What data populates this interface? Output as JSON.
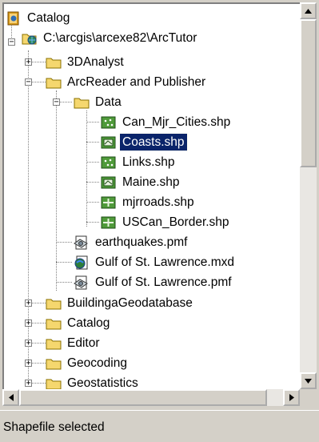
{
  "tree": {
    "root_label": "Catalog",
    "connection_label": "C:\\arcgis\\arcexe82\\ArcTutor",
    "items": {
      "analyst": "3DAnalyst",
      "arcreader": "ArcReader and Publisher",
      "data": "Data",
      "can_cities": "Can_Mjr_Cities.shp",
      "coasts": "Coasts.shp",
      "links": "Links.shp",
      "maine": "Maine.shp",
      "mjrroads": "mjrroads.shp",
      "uscan": "USCan_Border.shp",
      "earthquakes": "earthquakes.pmf",
      "gulf_mxd": "Gulf of St. Lawrence.mxd",
      "gulf_pmf": "Gulf of St. Lawrence.pmf",
      "building": "BuildingaGeodatabase",
      "catalog": "Catalog",
      "editor": "Editor",
      "geocoding": "Geocoding",
      "geostatistics": "Geostatistics"
    },
    "selected_item": "Coasts.shp"
  },
  "status": {
    "text": "Shapefile selected"
  },
  "colors": {
    "selection": "#0a246a",
    "folder": "#f5d76e",
    "window_bg": "#d4d0c8"
  }
}
